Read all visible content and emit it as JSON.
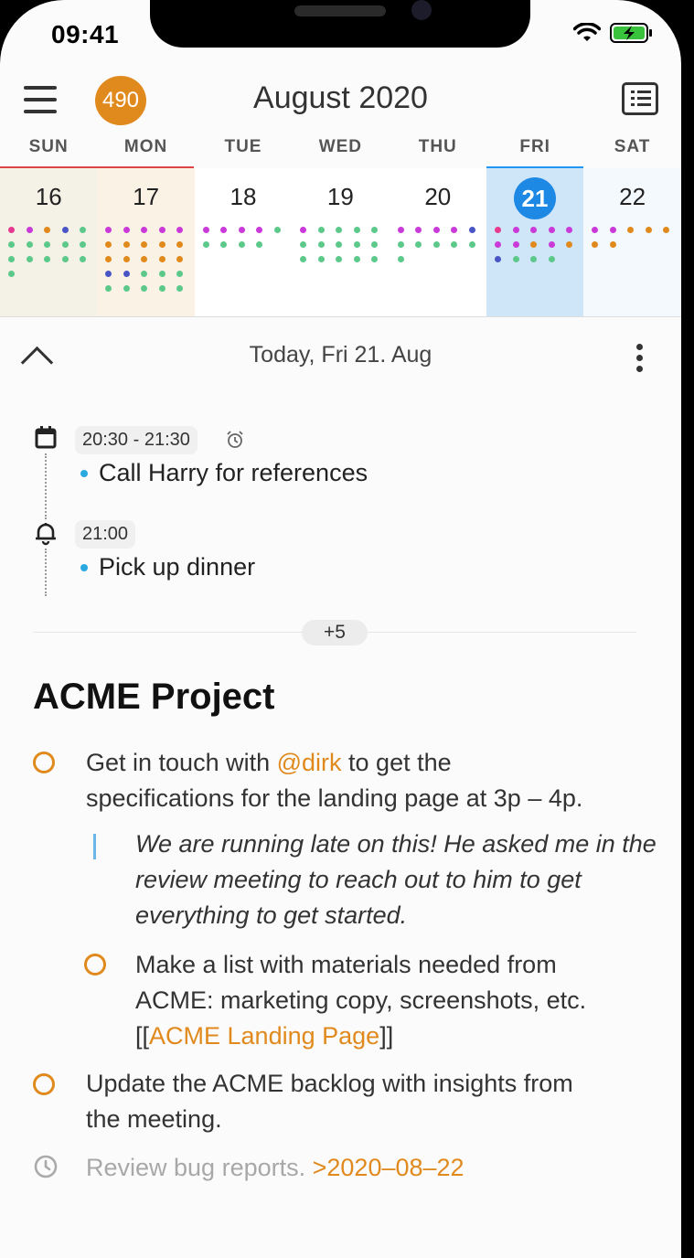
{
  "status_bar": {
    "time": "09:41"
  },
  "header": {
    "badge_count": "490",
    "month_title": "August 2020"
  },
  "weekdays": [
    "SUN",
    "MON",
    "TUE",
    "WED",
    "THU",
    "FRI",
    "SAT"
  ],
  "days": [
    {
      "num": "16",
      "bg": "#f4f1e6",
      "today": false,
      "dots": [
        "#e53a8f",
        "#c93ad8",
        "#e08a1e",
        "#4955c4",
        "#5cc98a",
        "#5cc98a",
        "#5cc98a",
        "#5cc98a",
        "#5cc98a",
        "#5cc98a",
        "#5cc98a",
        "#5cc98a",
        "#5cc98a",
        "#5cc98a",
        "#5cc98a",
        "#5cc98a"
      ]
    },
    {
      "num": "17",
      "bg": "#fbf2e6",
      "today": false,
      "dots": [
        "#c93ad8",
        "#c93ad8",
        "#c93ad8",
        "#c93ad8",
        "#c93ad8",
        "#e08a1e",
        "#e08a1e",
        "#e08a1e",
        "#e08a1e",
        "#e08a1e",
        "#e08a1e",
        "#e08a1e",
        "#e08a1e",
        "#e08a1e",
        "#e08a1e",
        "#4955c4",
        "#4955c4",
        "#5cc98a",
        "#5cc98a",
        "#5cc98a",
        "#5cc98a",
        "#5cc98a",
        "#5cc98a",
        "#5cc98a",
        "#5cc98a"
      ]
    },
    {
      "num": "18",
      "bg": "#ffffff",
      "today": false,
      "dots": [
        "#c93ad8",
        "#c93ad8",
        "#c93ad8",
        "#c93ad8",
        "#5cc98a",
        "#5cc98a",
        "#5cc98a",
        "#5cc98a",
        "#5cc98a"
      ]
    },
    {
      "num": "19",
      "bg": "#ffffff",
      "today": false,
      "dots": [
        "#c93ad8",
        "#5cc98a",
        "#5cc98a",
        "#5cc98a",
        "#5cc98a",
        "#5cc98a",
        "#5cc98a",
        "#5cc98a",
        "#5cc98a",
        "#5cc98a",
        "#5cc98a",
        "#5cc98a",
        "#5cc98a",
        "#5cc98a",
        "#5cc98a"
      ]
    },
    {
      "num": "20",
      "bg": "#ffffff",
      "today": false,
      "dots": [
        "#c93ad8",
        "#c93ad8",
        "#c93ad8",
        "#c93ad8",
        "#4955c4",
        "#5cc98a",
        "#5cc98a",
        "#5cc98a",
        "#5cc98a",
        "#5cc98a",
        "#5cc98a"
      ]
    },
    {
      "num": "21",
      "bg": "#cfe6f9",
      "today": true,
      "dots": [
        "#e53a8f",
        "#c93ad8",
        "#c93ad8",
        "#c93ad8",
        "#c93ad8",
        "#c93ad8",
        "#c93ad8",
        "#e08a1e",
        "#c93ad8",
        "#e08a1e",
        "#4955c4",
        "#5cc98a",
        "#5cc98a",
        "#5cc98a"
      ]
    },
    {
      "num": "22",
      "bg": "#f3f9fd",
      "today": false,
      "dots": [
        "#c93ad8",
        "#c93ad8",
        "#e08a1e",
        "#e08a1e",
        "#e08a1e",
        "#e08a1e",
        "#e08a1e"
      ]
    }
  ],
  "agenda": {
    "title": "Today, Fri 21. Aug"
  },
  "events": [
    {
      "icon": "calendar-icon",
      "time": "20:30 - 21:30",
      "has_alarm": true,
      "text": "Call Harry for references"
    },
    {
      "icon": "bell-icon",
      "time": "21:00",
      "has_alarm": false,
      "text": "Pick up dinner"
    }
  ],
  "more_count": "+5",
  "project": {
    "title": "ACME Project",
    "task1_pre": "Get in touch with ",
    "task1_mention": "@dirk",
    "task1_post": " to get the",
    "task1_line2": "specifications for the landing page at 3p – 4p.",
    "quote": "We are running late on this! He asked me in the review meeting to reach out to him to get everything to get started.",
    "subtask_line1": "Make a list with materials needed from",
    "subtask_line2": "ACME: marketing copy, screenshots, etc.",
    "subtask_link_open": "[[",
    "subtask_link": "ACME Landing Page",
    "subtask_link_close": "]]",
    "task2_line1": "Update the ACME backlog with insights from",
    "task2_line2": "the meeting.",
    "scheduled_text": "Review bug reports. ",
    "scheduled_date": ">2020–08–22"
  },
  "accent_color": "#e08a1e",
  "today_color": "#1e88e5"
}
